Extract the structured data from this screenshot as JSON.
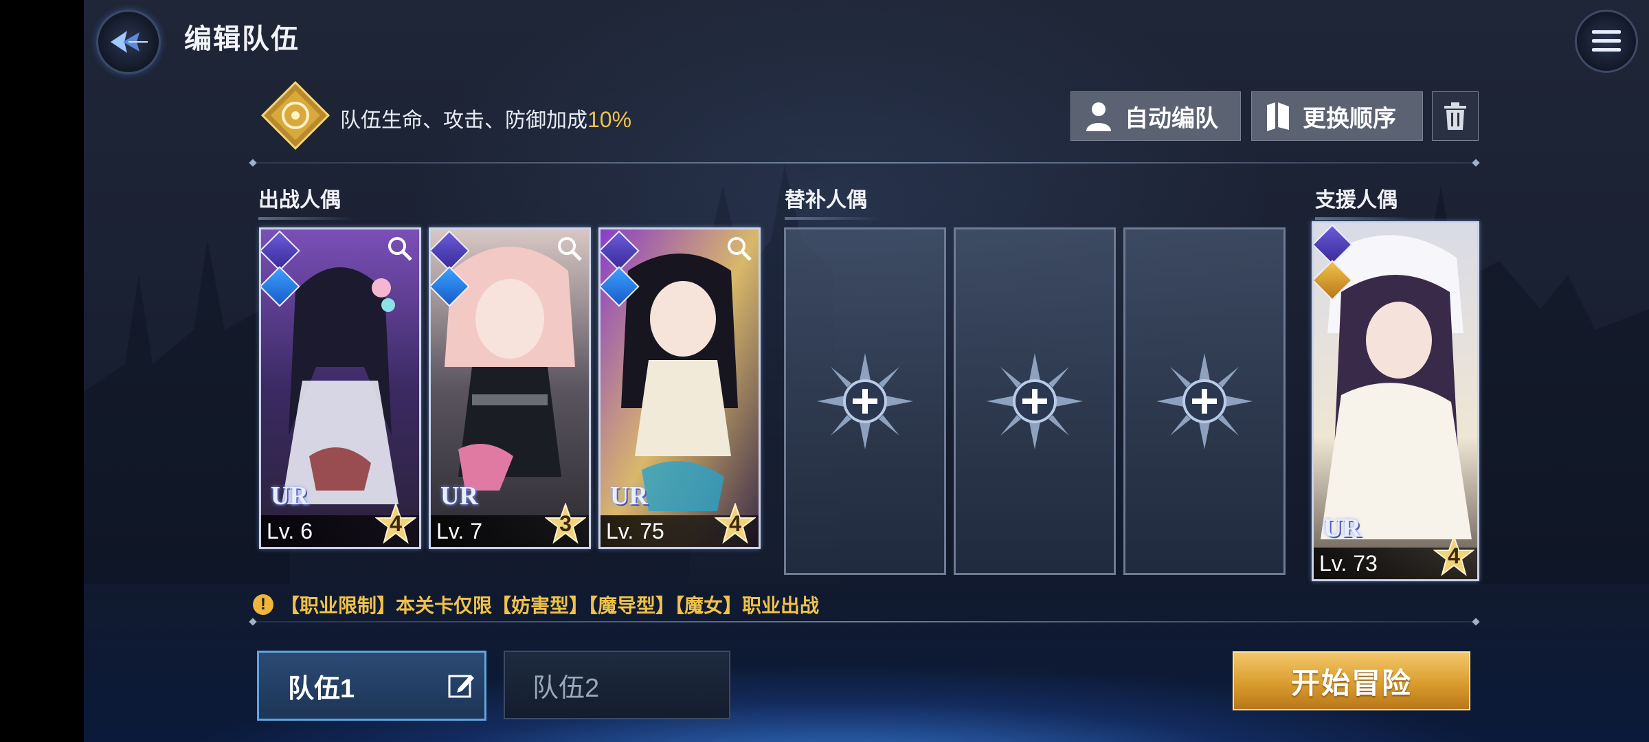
{
  "header": {
    "title": "编辑队伍"
  },
  "bonus": {
    "text": "队伍生命、攻击、防御加成",
    "percent": "10%"
  },
  "toolbar": {
    "auto_label": "自动编队",
    "order_label": "更换顺序"
  },
  "sections": {
    "battle": "出战人偶",
    "substitute": "替补人偶",
    "support": "支援人偶"
  },
  "battle_cards": [
    {
      "rarity": "UR",
      "level": "Lv. 6",
      "stars": "4"
    },
    {
      "rarity": "UR",
      "level": "Lv. 7",
      "stars": "3"
    },
    {
      "rarity": "UR",
      "level": "Lv. 75",
      "stars": "4"
    }
  ],
  "support_card": {
    "rarity": "UR",
    "level": "Lv. 73",
    "stars": "4"
  },
  "restriction": {
    "text": "【职业限制】本关卡仅限【妨害型】【魔导型】【魔女】职业出战"
  },
  "teams": {
    "tab1": "队伍1",
    "tab2": "队伍2"
  },
  "start_button": "开始冒险",
  "colors": {
    "accent_gold": "#f0c24a",
    "tab_active_border": "#5fa6e0"
  }
}
